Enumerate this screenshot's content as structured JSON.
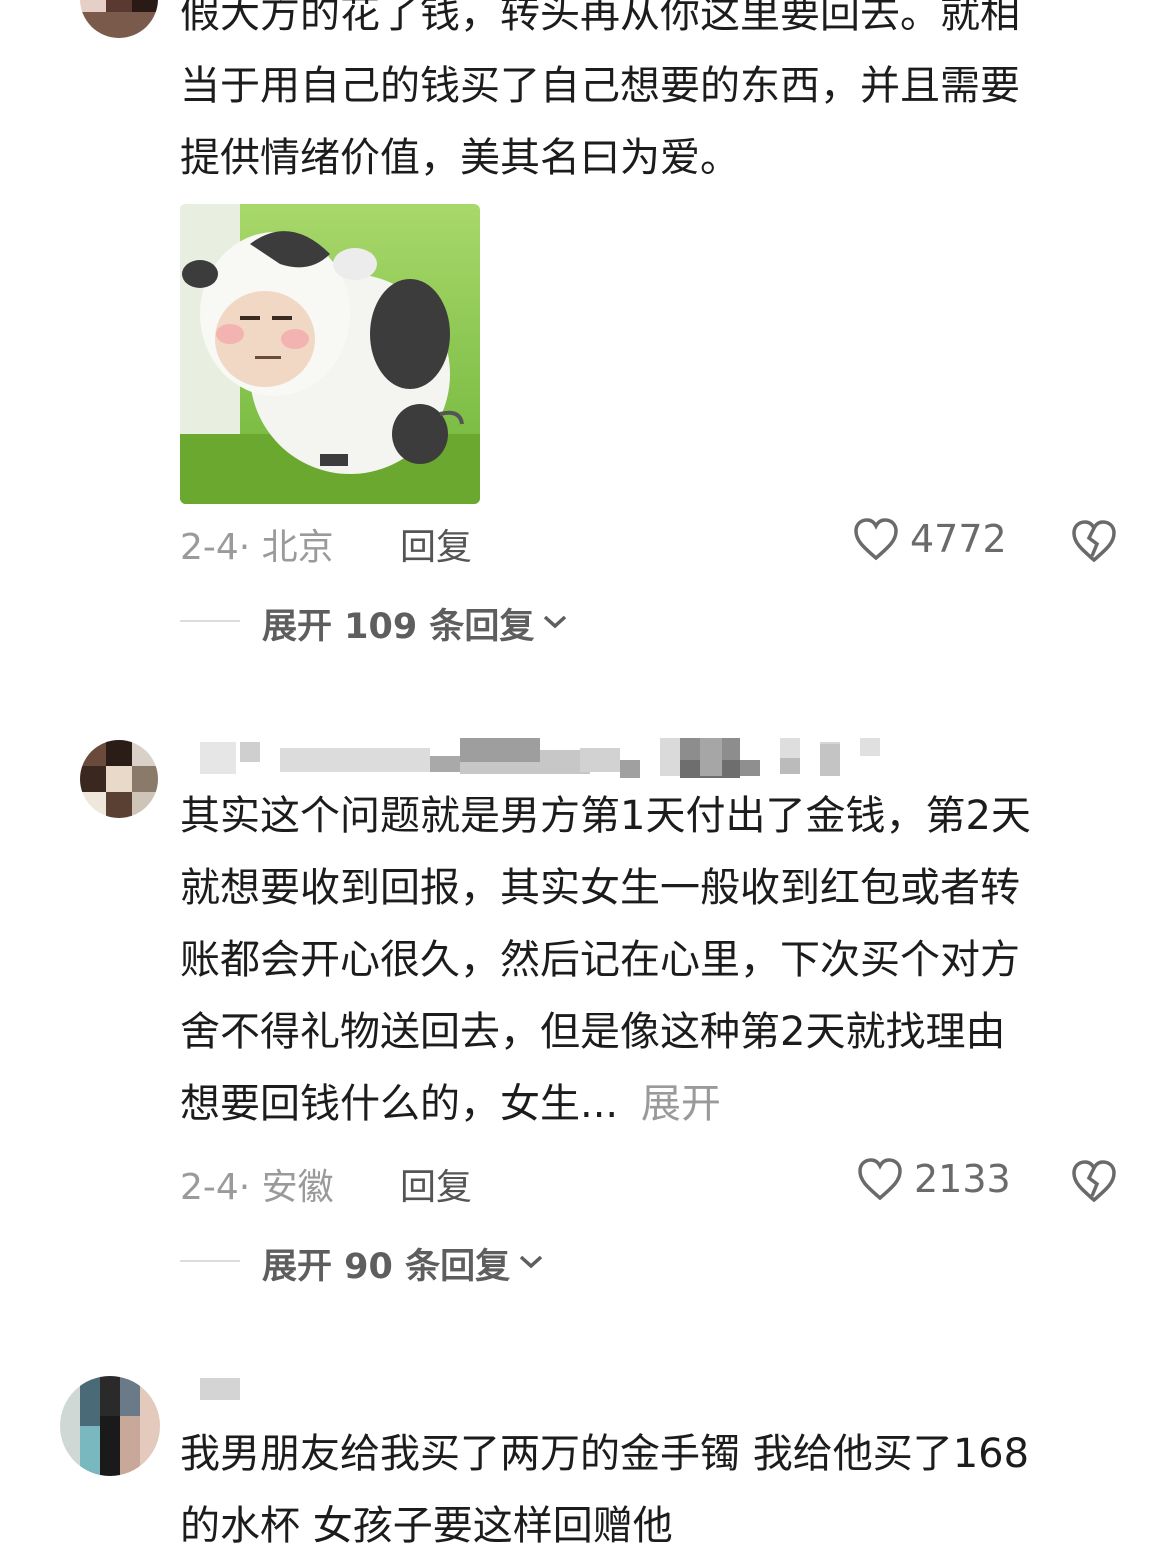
{
  "comments": [
    {
      "text_lines": [
        "假大方的花了钱，转头再从你这里要回去。就相",
        "当于用自己的钱买了自己想要的东西，并且需要",
        "提供情绪价值，美其名曰为爱。"
      ],
      "sticker": "cow-meme-sticker",
      "date_location": "2-4· 北京",
      "reply_label": "回复",
      "likes": "4772",
      "expand_label": "展开 109 条回复"
    },
    {
      "text_lines": [
        "其实这个问题就是男方第1天付出了金钱，第2天",
        "就想要收到回报，其实女生一般收到红包或者转",
        "账都会开心很久，然后记在心里，下次买个对方",
        "舍不得礼物送回去，但是像这种第2天就找理由"
      ],
      "last_line": "想要回钱什么的，女生...",
      "more_label": "展开",
      "date_location": "2-4· 安徽",
      "reply_label": "回复",
      "likes": "2133",
      "expand_label": "展开 90 条回复"
    },
    {
      "text_lines": [
        "我男朋友给我买了两万的金手镯 我给他买了168",
        "的水杯 女孩子要这样回赠他"
      ]
    }
  ],
  "icons": {
    "like": "heart-outline-icon",
    "dislike": "broken-heart-icon",
    "expand": "chevron-down-icon"
  },
  "colors": {
    "text": "#1c1c1c",
    "meta": "#9a9a9a",
    "grass": "#7cc242"
  }
}
